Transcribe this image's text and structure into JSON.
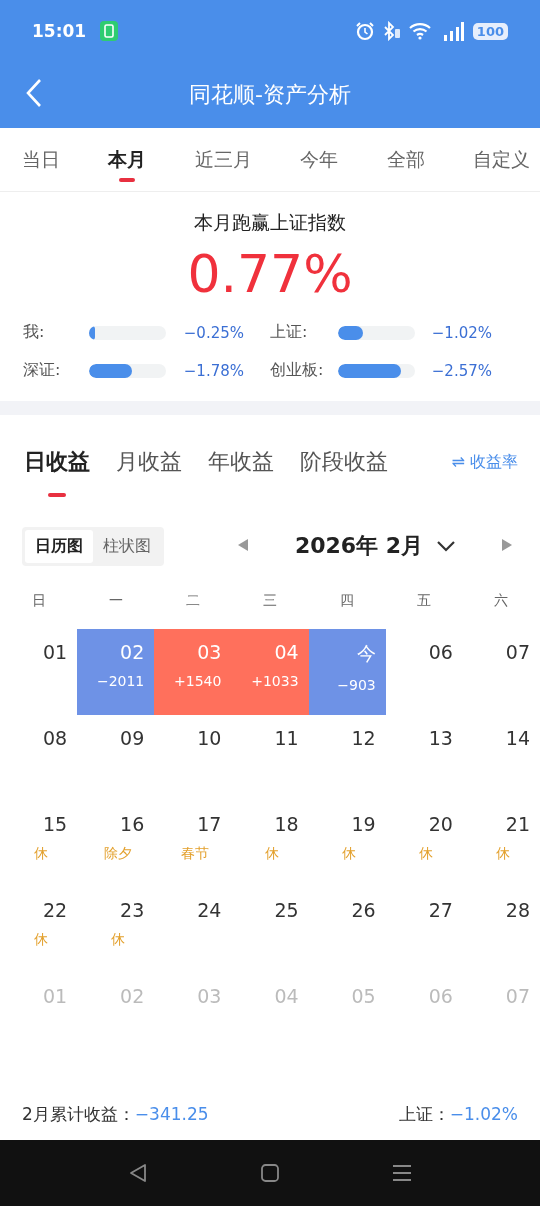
{
  "status_bar": {
    "time": "15:01",
    "battery": "100"
  },
  "header": {
    "title": "同花顺-资产分析"
  },
  "period_tabs": [
    {
      "label": "当日",
      "selected": false
    },
    {
      "label": "本月",
      "selected": true
    },
    {
      "label": "近三月",
      "selected": false
    },
    {
      "label": "今年",
      "selected": false
    },
    {
      "label": "全部",
      "selected": false
    },
    {
      "label": "自定义",
      "selected": false
    }
  ],
  "summary": {
    "title": "本月跑赢上证指数",
    "value": "0.77%",
    "comparisons": [
      {
        "label": "我:",
        "level": 0.08,
        "value": "−0.25%"
      },
      {
        "label": "上证:",
        "level": 0.32,
        "value": "−1.02%"
      },
      {
        "label": "深证:",
        "level": 0.56,
        "value": "−1.78%"
      },
      {
        "label": "创业板:",
        "level": 0.82,
        "value": "−2.57%"
      }
    ]
  },
  "profit_tabs": [
    {
      "label": "日收益",
      "selected": true
    },
    {
      "label": "月收益",
      "selected": false
    },
    {
      "label": "年收益",
      "selected": false
    },
    {
      "label": "阶段收益",
      "selected": false
    }
  ],
  "switch_link": {
    "icon": "⇌",
    "label": "收益率"
  },
  "view_toggle": [
    {
      "label": "日历图",
      "selected": true
    },
    {
      "label": "柱状图",
      "selected": false
    }
  ],
  "month": "2026年 2月",
  "weekdays": [
    "日",
    "一",
    "二",
    "三",
    "四",
    "五",
    "六"
  ],
  "days": [
    {
      "day": "01",
      "kind": "current"
    },
    {
      "day": "02",
      "kind": "current",
      "color": "#6e92e6",
      "change": "−2011"
    },
    {
      "day": "03",
      "kind": "current",
      "color": "#ff705c",
      "change": "+1540"
    },
    {
      "day": "04",
      "kind": "current",
      "color": "#ff705c",
      "change": "+1033"
    },
    {
      "day": "今",
      "kind": "current",
      "color": "#6e92e6",
      "change": "−903"
    },
    {
      "day": "06",
      "kind": "current"
    },
    {
      "day": "07",
      "kind": "current"
    },
    {
      "day": "08",
      "kind": "current"
    },
    {
      "day": "09",
      "kind": "current"
    },
    {
      "day": "10",
      "kind": "current"
    },
    {
      "day": "11",
      "kind": "current"
    },
    {
      "day": "12",
      "kind": "current"
    },
    {
      "day": "13",
      "kind": "current"
    },
    {
      "day": "14",
      "kind": "current"
    },
    {
      "day": "15",
      "kind": "current",
      "note": "休"
    },
    {
      "day": "16",
      "kind": "current",
      "note": "除夕"
    },
    {
      "day": "17",
      "kind": "current",
      "note": "春节"
    },
    {
      "day": "18",
      "kind": "current",
      "note": "休"
    },
    {
      "day": "19",
      "kind": "current",
      "note": "休"
    },
    {
      "day": "20",
      "kind": "current",
      "note": "休"
    },
    {
      "day": "21",
      "kind": "current",
      "note": "休"
    },
    {
      "day": "22",
      "kind": "current",
      "note": "休"
    },
    {
      "day": "23",
      "kind": "current",
      "note": "休"
    },
    {
      "day": "24",
      "kind": "current"
    },
    {
      "day": "25",
      "kind": "current"
    },
    {
      "day": "26",
      "kind": "current"
    },
    {
      "day": "27",
      "kind": "current"
    },
    {
      "day": "28",
      "kind": "current"
    },
    {
      "day": "01",
      "kind": "outside"
    },
    {
      "day": "02",
      "kind": "outside"
    },
    {
      "day": "03",
      "kind": "outside"
    },
    {
      "day": "04",
      "kind": "outside"
    },
    {
      "day": "05",
      "kind": "outside"
    },
    {
      "day": "06",
      "kind": "outside"
    },
    {
      "day": "07",
      "kind": "outside"
    }
  ],
  "footer": {
    "total_label": "2月累计收益：",
    "total_value": "−341.25",
    "index_label": "上证：",
    "index_value": "−1.02%"
  }
}
